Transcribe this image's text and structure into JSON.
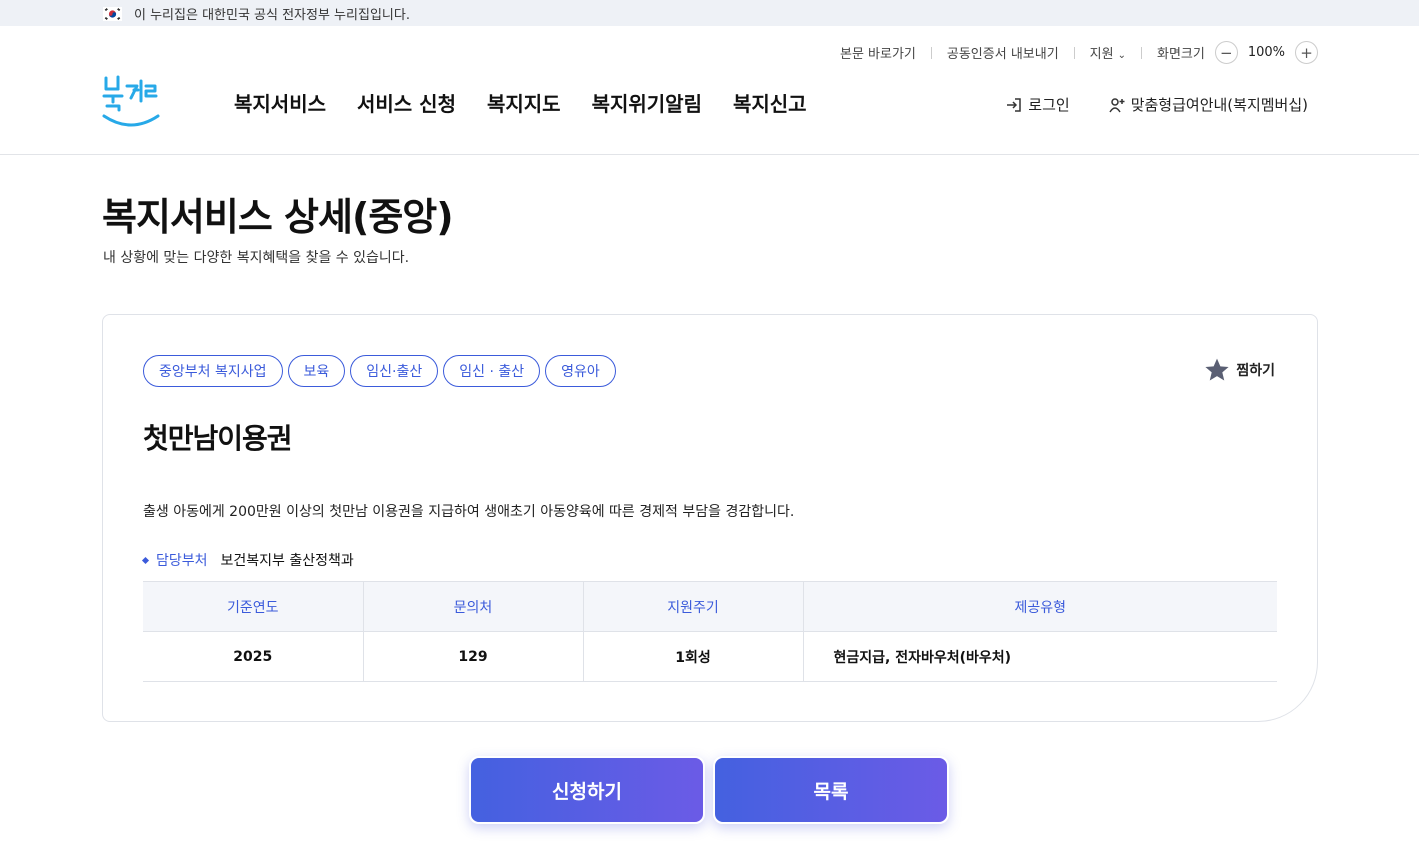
{
  "gov_banner": {
    "text": "이 누리집은 대한민국 공식 전자정부 누리집입니다."
  },
  "utility": {
    "skip_to_content": "본문 바로가기",
    "export_cert": "공동인증서 내보내기",
    "support": "지원",
    "screen_size_label": "화면크기",
    "zoom_value": "100%",
    "zoom_out": "−",
    "zoom_in": "+"
  },
  "logo": {
    "alt": "복지로"
  },
  "nav": {
    "items": [
      "복지서비스",
      "서비스 신청",
      "복지지도",
      "복지위기알림",
      "복지신고"
    ]
  },
  "member": {
    "login": "로그인",
    "membership": "맞춤형급여안내(복지멤버십)"
  },
  "page": {
    "title": "복지서비스 상세(중앙)",
    "description": "내 상황에 맞는 다양한 복지혜택을 찾을 수 있습니다."
  },
  "service": {
    "tags": [
      "중앙부처 복지사업",
      "보육",
      "임신·출산",
      "임신 · 출산",
      "영유아"
    ],
    "favorite_label": "찜하기",
    "title": "첫만남이용권",
    "description": "출생 아동에게 200만원 이상의 첫만남 이용권을 지급하여 생애초기 아동양육에 따른 경제적 부담을 경감합니다.",
    "dept_label": "담당부처",
    "dept_value": "보건복지부 출산정책과",
    "table": {
      "headers": [
        "기준연도",
        "문의처",
        "지원주기",
        "제공유형"
      ],
      "row": [
        "2025",
        "129",
        "1회성",
        "현금지급, 전자바우처(바우처)"
      ]
    }
  },
  "actions": {
    "apply": "신청하기",
    "list": "목록"
  },
  "colors": {
    "accent": "#3b5bdb",
    "logo_blue": "#27a9e8",
    "button_gradient_start": "#4461e0",
    "button_gradient_end": "#6b5be6"
  }
}
